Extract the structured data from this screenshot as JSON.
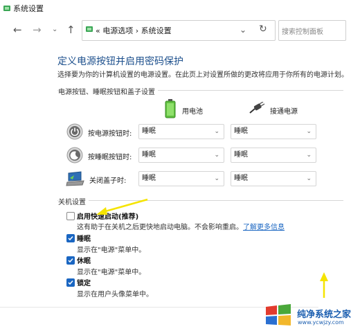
{
  "window": {
    "title": "系统设置"
  },
  "nav": {
    "breadcrumb_prefix": "«",
    "breadcrumb_parent": "电源选项",
    "breadcrumb_sep": "›",
    "breadcrumb_current": "系统设置",
    "refresh_icon": "refresh-icon",
    "search_placeholder": "搜索控制面板"
  },
  "page": {
    "heading": "定义电源按钮并启用密码保护",
    "description": "选择要为你的计算机设置的电源设置。在此页上对设置所做的更改将应用于你所有的电源计划。"
  },
  "power_section": {
    "label": "电源按钮、睡眠按钮和盖子设置",
    "col_battery": "用电池",
    "col_plugged": "接通电源",
    "rows": [
      {
        "label": "按电源按钮时:",
        "battery": "睡眠",
        "plugged": "睡眠",
        "icon": "power-button-icon"
      },
      {
        "label": "按睡眠按钮时:",
        "battery": "睡眠",
        "plugged": "睡眠",
        "icon": "sleep-button-icon"
      },
      {
        "label": "关闭盖子时:",
        "battery": "睡眠",
        "plugged": "睡眠",
        "icon": "laptop-lid-icon"
      }
    ]
  },
  "shutdown_section": {
    "label": "关机设置",
    "items": [
      {
        "label": "启用快速启动(推荐)",
        "checked": false,
        "desc": "这有助于在关机之后更快地启动电脑。不会影响重启。",
        "link": "了解更多信息"
      },
      {
        "label": "睡眠",
        "checked": true,
        "desc": "显示在\"电源\"菜单中。"
      },
      {
        "label": "休眠",
        "checked": true,
        "desc": "显示在\"电源\"菜单中。"
      },
      {
        "label": "锁定",
        "checked": true,
        "desc": "显示在用户头像菜单中。"
      }
    ]
  },
  "watermark": {
    "title": "纯净系统之家",
    "url": "www.ycwjzy.com"
  },
  "colors": {
    "heading": "#1c4f8c",
    "checkbox": "#1a66c2",
    "annotation_arrow": "#f5e400"
  }
}
